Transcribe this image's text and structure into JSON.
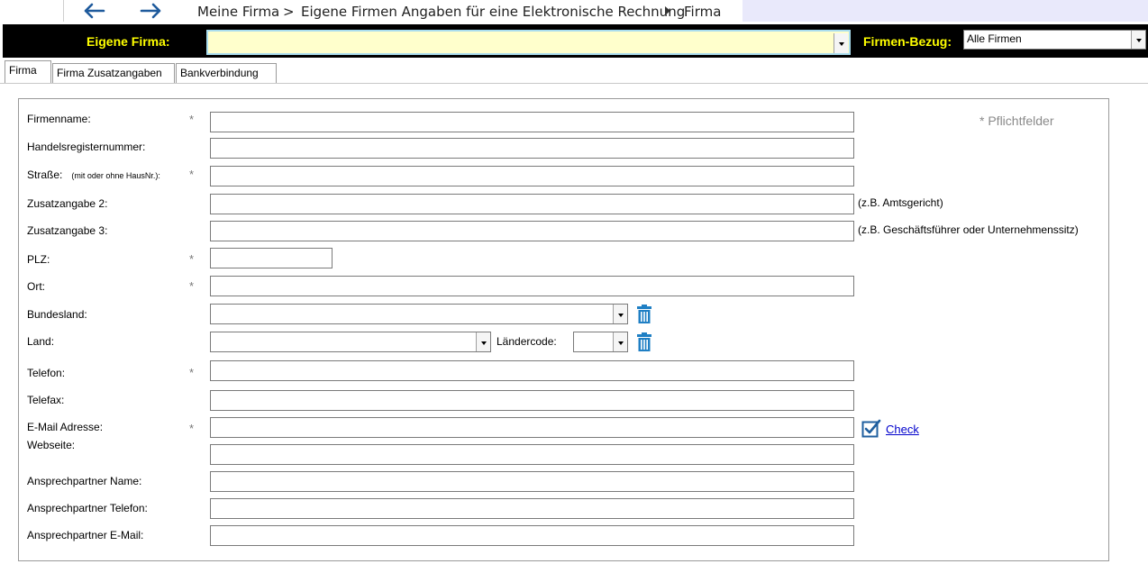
{
  "nav": {
    "breadcrumb_1": "Meine Firma",
    "separator": ">",
    "breadcrumb_2": "Eigene Firmen Angaben für eine Elektronische Rechnung",
    "breadcrumb_3": "Firma"
  },
  "header": {
    "company_label": "Eigene Firma:",
    "company_value": "",
    "relation_label": "Firmen-Bezug:",
    "relation_value": "Alle Firmen"
  },
  "tabs": [
    {
      "label": "Firma",
      "active": true
    },
    {
      "label": "Firma Zusatzangaben",
      "active": false
    },
    {
      "label": "Bankverbindung",
      "active": false
    }
  ],
  "form": {
    "required_note": "* Pflichtfelder",
    "required_marker": "*",
    "fields": {
      "firmenname": {
        "label": "Firmenname:",
        "value": ""
      },
      "handelsregister": {
        "label": "Handelsregisternummer:",
        "value": ""
      },
      "strasse": {
        "label": "Straße:",
        "sublabel": "(mit oder ohne HausNr.):",
        "value": ""
      },
      "zusatz2": {
        "label": "Zusatzangabe 2:",
        "value": "",
        "hint": "(z.B. Amtsgericht)"
      },
      "zusatz3": {
        "label": "Zusatzangabe 3:",
        "value": "",
        "hint": "(z.B. Geschäftsführer oder Unternehmenssitz)"
      },
      "plz": {
        "label": "PLZ:",
        "value": ""
      },
      "ort": {
        "label": "Ort:",
        "value": ""
      },
      "bundesland": {
        "label": "Bundesland:",
        "value": ""
      },
      "land": {
        "label": "Land:",
        "value": ""
      },
      "laendercode": {
        "label": "Ländercode:",
        "value": ""
      },
      "telefon": {
        "label": "Telefon:",
        "value": ""
      },
      "telefax": {
        "label": "Telefax:",
        "value": ""
      },
      "email": {
        "label": "E-Mail Adresse:",
        "value": "",
        "check_label": "Check"
      },
      "webseite": {
        "label": "Webseite:",
        "value": ""
      },
      "ap_name": {
        "label": "Ansprechpartner Name:",
        "value": ""
      },
      "ap_telefon": {
        "label": "Ansprechpartner Telefon:",
        "value": ""
      },
      "ap_email": {
        "label": "Ansprechpartner E-Mail:",
        "value": ""
      }
    }
  },
  "colors": {
    "header_bg": "#000000",
    "header_label": "#ffff00",
    "company_field_bg": "#ffffcc",
    "company_field_border": "#aaddee",
    "nav_arrow": "#1e5a9c",
    "trash_icon": "#1f7fc4",
    "link": "#0000cc"
  }
}
